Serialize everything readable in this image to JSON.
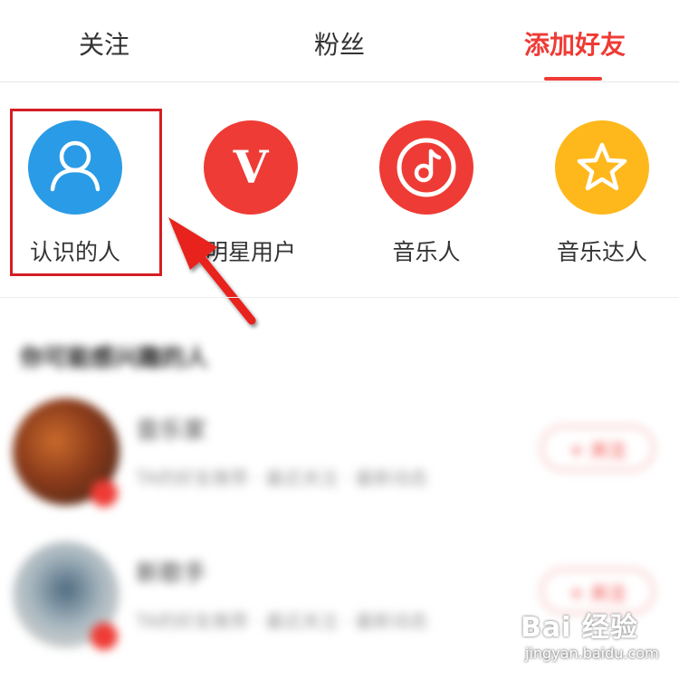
{
  "tabs": [
    {
      "label": "关注",
      "active": false
    },
    {
      "label": "粉丝",
      "active": false
    },
    {
      "label": "添加好友",
      "active": true
    }
  ],
  "colors": {
    "accent": "#ef3b35",
    "blue": "#2a9be6",
    "red": "#ef3b35",
    "yellow": "#ffb81c",
    "highlight_box": "#d51e23"
  },
  "categories": [
    {
      "label": "认识的人",
      "icon": "person-icon"
    },
    {
      "label": "明星用户",
      "icon": "v-letter-icon"
    },
    {
      "label": "音乐人",
      "icon": "music-note-icon"
    },
    {
      "label": "音乐达人",
      "icon": "star-icon"
    }
  ],
  "suggestions": {
    "title": "你可能感兴趣的人",
    "rows": [
      {
        "name": "音乐家",
        "sub": "TA的好友推荐 · 最近关注 · 最新动态",
        "button": "+ 关注"
      },
      {
        "name": "新歌手",
        "sub": "TA的好友推荐 · 最近关注 · 最新动态",
        "button": "+ 关注"
      }
    ]
  },
  "watermark": {
    "main": "Bai 经验",
    "sub": "jingyan.baidu.com"
  }
}
